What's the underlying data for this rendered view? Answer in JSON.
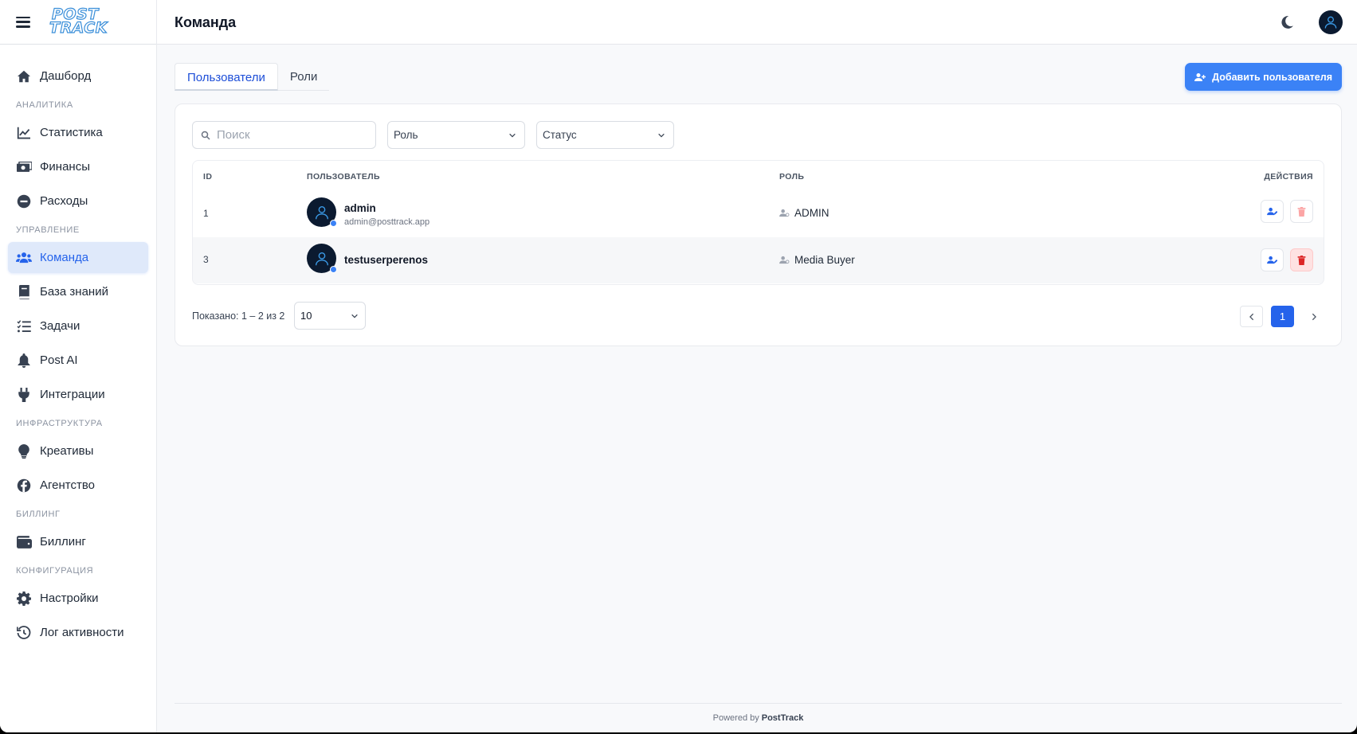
{
  "app": {
    "logo_line1": "POST",
    "logo_line2": "TRACK",
    "page_title": "Команда"
  },
  "sidebar": {
    "items": [
      {
        "type": "item",
        "label": "Дашборд",
        "icon": "home-icon"
      },
      {
        "type": "section",
        "label": "АНАЛИТИКА"
      },
      {
        "type": "item",
        "label": "Статистика",
        "icon": "chart-line-icon"
      },
      {
        "type": "item",
        "label": "Финансы",
        "icon": "money-icon"
      },
      {
        "type": "item",
        "label": "Расходы",
        "icon": "minus-circle-icon"
      },
      {
        "type": "section",
        "label": "УПРАВЛЕНИЕ"
      },
      {
        "type": "item",
        "label": "Команда",
        "icon": "users-icon",
        "active": true
      },
      {
        "type": "item",
        "label": "База знаний",
        "icon": "book-icon"
      },
      {
        "type": "item",
        "label": "Задачи",
        "icon": "tasks-icon"
      },
      {
        "type": "item",
        "label": "Post AI",
        "icon": "bell-icon"
      },
      {
        "type": "item",
        "label": "Интеграции",
        "icon": "plug-icon"
      },
      {
        "type": "section",
        "label": "ИНФРАСТРУКТУРА"
      },
      {
        "type": "item",
        "label": "Креативы",
        "icon": "lightbulb-icon"
      },
      {
        "type": "item",
        "label": "Агентство",
        "icon": "facebook-icon"
      },
      {
        "type": "section",
        "label": "БИЛЛИНГ"
      },
      {
        "type": "item",
        "label": "Биллинг",
        "icon": "wallet-icon"
      },
      {
        "type": "section",
        "label": "КОНФИГУРАЦИЯ"
      },
      {
        "type": "item",
        "label": "Настройки",
        "icon": "gear-icon"
      },
      {
        "type": "item",
        "label": "Лог активности",
        "icon": "history-icon"
      }
    ]
  },
  "tabs": [
    {
      "label": "Пользователи",
      "active": true
    },
    {
      "label": "Роли",
      "active": false
    }
  ],
  "add_button": {
    "label": "Добавить пользователя",
    "icon": "user-plus-icon"
  },
  "filters": {
    "search_placeholder": "Поиск",
    "role_select": "Роль",
    "status_select": "Статус"
  },
  "table": {
    "headers": {
      "id": "ID",
      "user": "ПОЛЬЗОВАТЕЛЬ",
      "role": "РОЛЬ",
      "actions": "ДЕЙСТВИЯ"
    },
    "rows": [
      {
        "id": "1",
        "name": "admin",
        "email": "admin@posttrack.app",
        "role": "ADMIN",
        "delete_enabled": false
      },
      {
        "id": "3",
        "name": "testuserperenos",
        "email": "",
        "role": "Media Buyer",
        "delete_enabled": true
      }
    ]
  },
  "pagination": {
    "info": "Показано: 1 – 2 из 2",
    "per_page": "10",
    "current_page": "1"
  },
  "footer": {
    "prefix": "Powered by",
    "brand": "PostTrack"
  },
  "colors": {
    "accent": "#3b82f6",
    "active_bg": "#dfe9fa",
    "danger": "#dc2626",
    "danger_light": "#fca5a5"
  }
}
